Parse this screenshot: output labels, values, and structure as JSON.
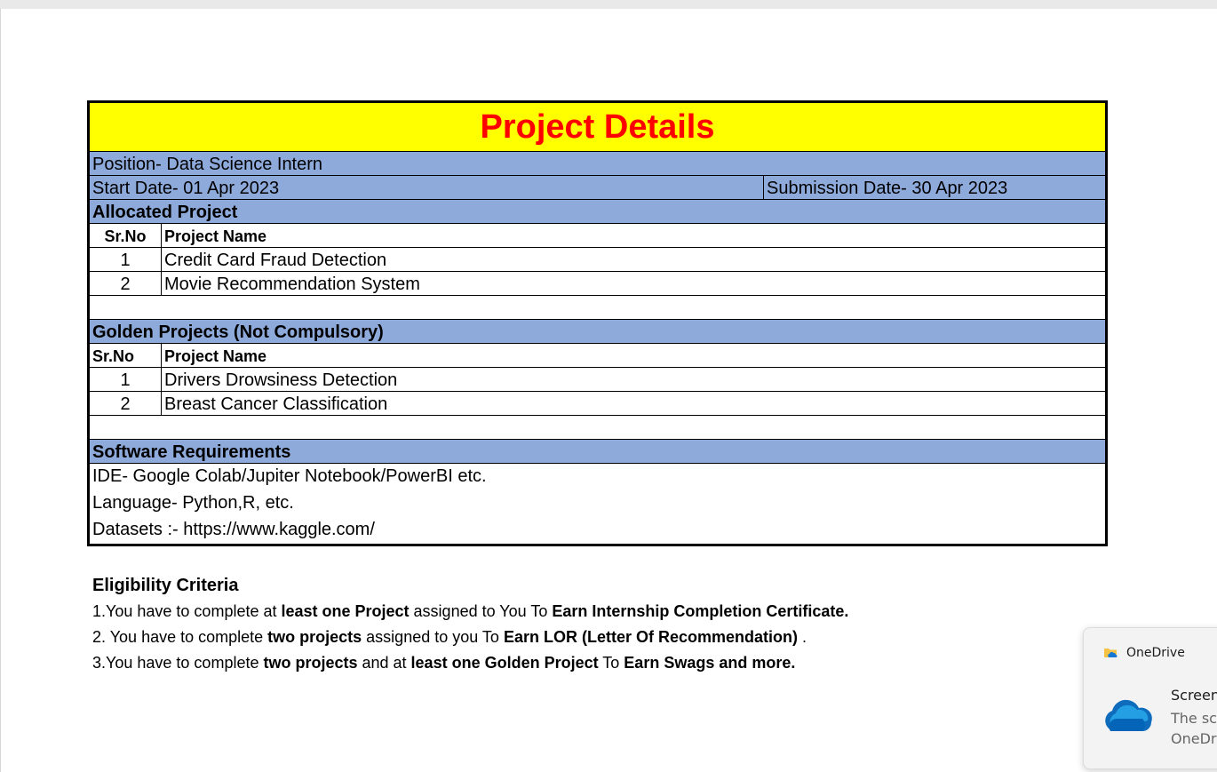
{
  "sheet": {
    "title": "Project Details",
    "position": "Position- Data Science Intern",
    "start_date": "Start Date- 01 Apr 2023",
    "submission_date": "Submission Date- 30 Apr 2023",
    "allocated": {
      "heading": "Allocated Project",
      "col_srno": "Sr.No",
      "col_name": "Project Name",
      "rows": [
        {
          "no": "1",
          "name": "Credit Card Fraud Detection"
        },
        {
          "no": "2",
          "name": "Movie Recommendation System"
        }
      ]
    },
    "golden": {
      "heading": "Golden Projects (Not Compulsory)",
      "col_srno": "Sr.No",
      "col_name": "Project Name",
      "rows": [
        {
          "no": "1",
          "name": "Drivers Drowsiness Detection"
        },
        {
          "no": "2",
          "name": "Breast Cancer Classification"
        }
      ]
    },
    "software": {
      "heading": "Software Requirements",
      "lines": [
        "IDE-  Google Colab/Jupiter Notebook/PowerBI etc.",
        "Language- Python,R, etc.",
        "Datasets :- https://www.kaggle.com/"
      ]
    }
  },
  "eligibility": {
    "heading": "Eligibility Criteria",
    "line1": {
      "a": "1.You have to complete at ",
      "b": "least one Project",
      "c": " assigned to You To ",
      "d": "Earn Internship Completion Certificate."
    },
    "line2": {
      "a": "2. You have to complete ",
      "b": "two projects",
      "c": " assigned to you To ",
      "d": "Earn LOR (Letter Of Recommendation)",
      "e": " ."
    },
    "line3": {
      "a": "3.You have to complete ",
      "b": "two projects",
      "c": " and at ",
      "d": "least one Golden Project",
      "e": " To ",
      "f": "Earn Swags and more."
    }
  },
  "toast": {
    "app_name": "OneDrive",
    "title": "Screen",
    "body_line1": "The scr",
    "body_line2": "OneDr",
    "icon": "onedrive-cloud-icon",
    "accent": "#0f6cbd"
  },
  "colors": {
    "title_bg": "#ffff00",
    "title_text": "#ff0000",
    "section_bg": "#8eaadb"
  }
}
